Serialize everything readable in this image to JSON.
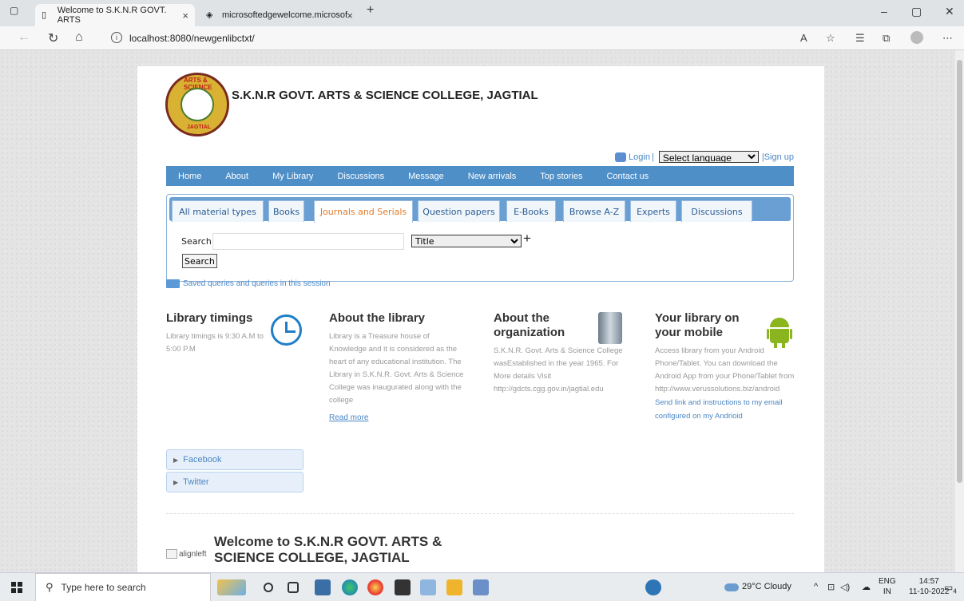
{
  "browser": {
    "tabs": [
      {
        "title": "Welcome to S.K.N.R GOVT. ARTS",
        "active": true
      },
      {
        "title": "microsoftedgewelcome.microsof",
        "active": false
      }
    ],
    "url": "localhost:8080/newgenlibctxt/",
    "new_tab_glyph": "+",
    "close_glyph": "×",
    "window_controls": [
      "–",
      "▢",
      "✕"
    ]
  },
  "site": {
    "title": "S.K.N.R GOVT. ARTS & SCIENCE COLLEGE, JAGTIAL",
    "logo_top_text": "ARTS & SCIENCE",
    "logo_bottom_text": "JAGTIAL",
    "login_label": "Login",
    "language_placeholder": "Select language",
    "signup_label": "Sign up"
  },
  "menu": [
    "Home",
    "About",
    "My Library",
    "Discussions",
    "Message",
    "New arrivals",
    "Top stories",
    "Contact us"
  ],
  "search_tabs": [
    "All material types",
    "Books",
    "Journals and Serials",
    "Question papers",
    "E-Books",
    "Browse A-Z",
    "Experts",
    "Discussions"
  ],
  "search": {
    "label": "Search",
    "field_option": "Title",
    "button_label": "Search",
    "add_glyph": "+",
    "saved_queries": "Saved queries and queries in this session"
  },
  "info": {
    "timings": {
      "title": "Library timings",
      "text": "Library timings is 9:30 A.M to 5:00 P.M"
    },
    "about_library": {
      "title": "About the library",
      "text": "Library is a Treasure house of Knowledge and it is considered as the heart of any educational institution. The Library in S.K.N.R. Govt. Arts & Science College was inaugurated along with the college",
      "read_more": "Read more"
    },
    "about_org": {
      "title": "About the organization",
      "text": "S.K.N.R. Govt. Arts & Science College wasEstablished in the year 1965. For More details Visit http://gdcts.cgg.gov.in/jagtial.edu"
    },
    "mobile": {
      "title": "Your library on your mobile",
      "text": "Access library from your Android Phone/Tablet. You can download the Android App from your Phone/Tablet from http://www.verussolutions.biz/android",
      "link": "Send link and instructions to my email configured on my Andrioid"
    }
  },
  "social": [
    "Facebook",
    "Twitter"
  ],
  "welcome": {
    "img_alt": "alignleft",
    "title": "Welcome to S.K.N.R GOVT. ARTS & SCIENCE COLLEGE, JAGTIAL"
  },
  "taskbar": {
    "search_placeholder": "Type here to search",
    "weather": "29°C  Cloudy",
    "lang_top": "ENG",
    "lang_bottom": "IN",
    "time": "14:57",
    "date": "11-10-2022",
    "notification_count": "4"
  },
  "colors": {
    "menu_bar": "#4f8fc8",
    "link": "#4a86c5",
    "active_tab": "#e07b2b"
  }
}
